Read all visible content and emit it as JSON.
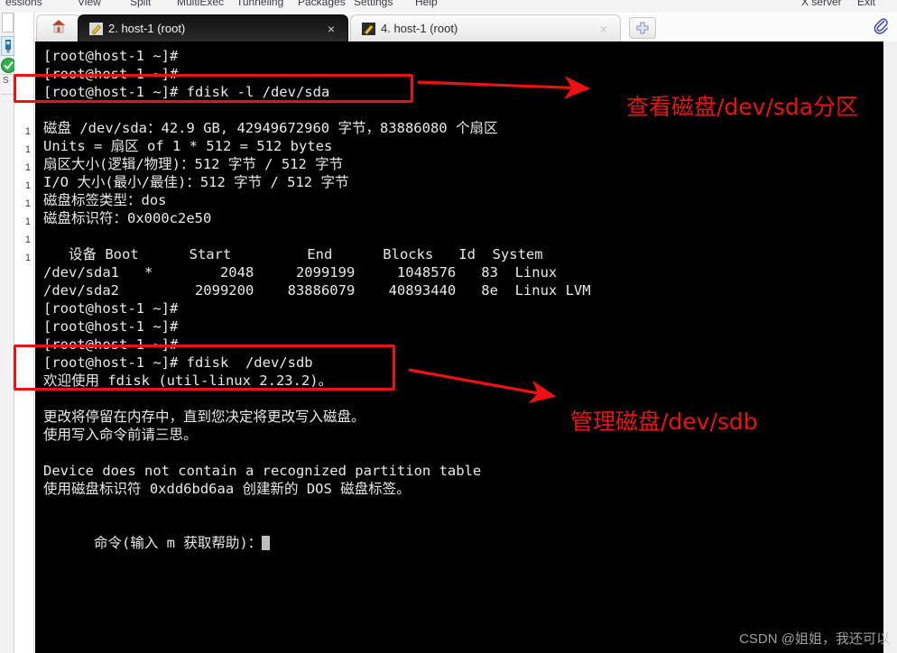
{
  "menubar": {
    "items": [
      "essions",
      "View",
      "Split",
      "MultiExec",
      "Tunneling",
      "Packages",
      "Settings",
      "Help"
    ],
    "right_items": [
      "X server",
      "Exit"
    ]
  },
  "tabbar": {
    "home_icon": "home-icon",
    "tabs": [
      {
        "icon": "terminal-session-icon",
        "label": "2. host-1 (root)",
        "close": "×",
        "active": true
      },
      {
        "icon": "terminal-session-icon",
        "label": "4. host-1 (root)",
        "close": "×",
        "active": false
      }
    ],
    "new_tab_label": "✚",
    "clip_icon": "paperclip-icon"
  },
  "rail": {
    "device_icon": "usb-device-icon",
    "status_icon": "green-check-icon",
    "session_letter": "S"
  },
  "gutter": {
    "line_numbers": [
      "1",
      "1",
      "1",
      "1",
      "1",
      "1",
      "1",
      "1"
    ]
  },
  "terminal": {
    "lines": [
      "[root@host-1 ~]#",
      "[root@host-1 ~]#",
      "[root@host-1 ~]# fdisk -l /dev/sda",
      "",
      "磁盘 /dev/sda：42.9 GB, 42949672960 字节，83886080 个扇区",
      "Units = 扇区 of 1 * 512 = 512 bytes",
      "扇区大小(逻辑/物理)：512 字节 / 512 字节",
      "I/O 大小(最小/最佳)：512 字节 / 512 字节",
      "磁盘标签类型：dos",
      "磁盘标识符：0x000c2e50",
      "",
      "   设备 Boot      Start         End      Blocks   Id  System",
      "/dev/sda1   *        2048     2099199     1048576   83  Linux",
      "/dev/sda2         2099200    83886079    40893440   8e  Linux LVM",
      "[root@host-1 ~]#",
      "[root@host-1 ~]#",
      "[root@host-1 ~]#",
      "",
      "[root@host-1 ~]# fdisk  /dev/sdb",
      "欢迎使用 fdisk (util-linux 2.23.2)。",
      "",
      "更改将停留在内存中，直到您决定将更改写入磁盘。",
      "使用写入命令前请三思。",
      "",
      "Device does not contain a recognized partition table",
      "使用磁盘标识符 0xdd6bd6aa 创建新的 DOS 磁盘标签。",
      "",
      "命令(输入 m 获取帮助)："
    ],
    "prompt_cursor": "█"
  },
  "annotations": {
    "accent_color": "#ee1111",
    "callouts": [
      {
        "name": "view-sda-partition",
        "text": "查看磁盘/dev/sda分区"
      },
      {
        "name": "manage-sdb-disk",
        "text": "管理磁盘/dev/sdb"
      }
    ]
  },
  "watermark": {
    "text": "CSDN @姐姐，我还可以"
  }
}
